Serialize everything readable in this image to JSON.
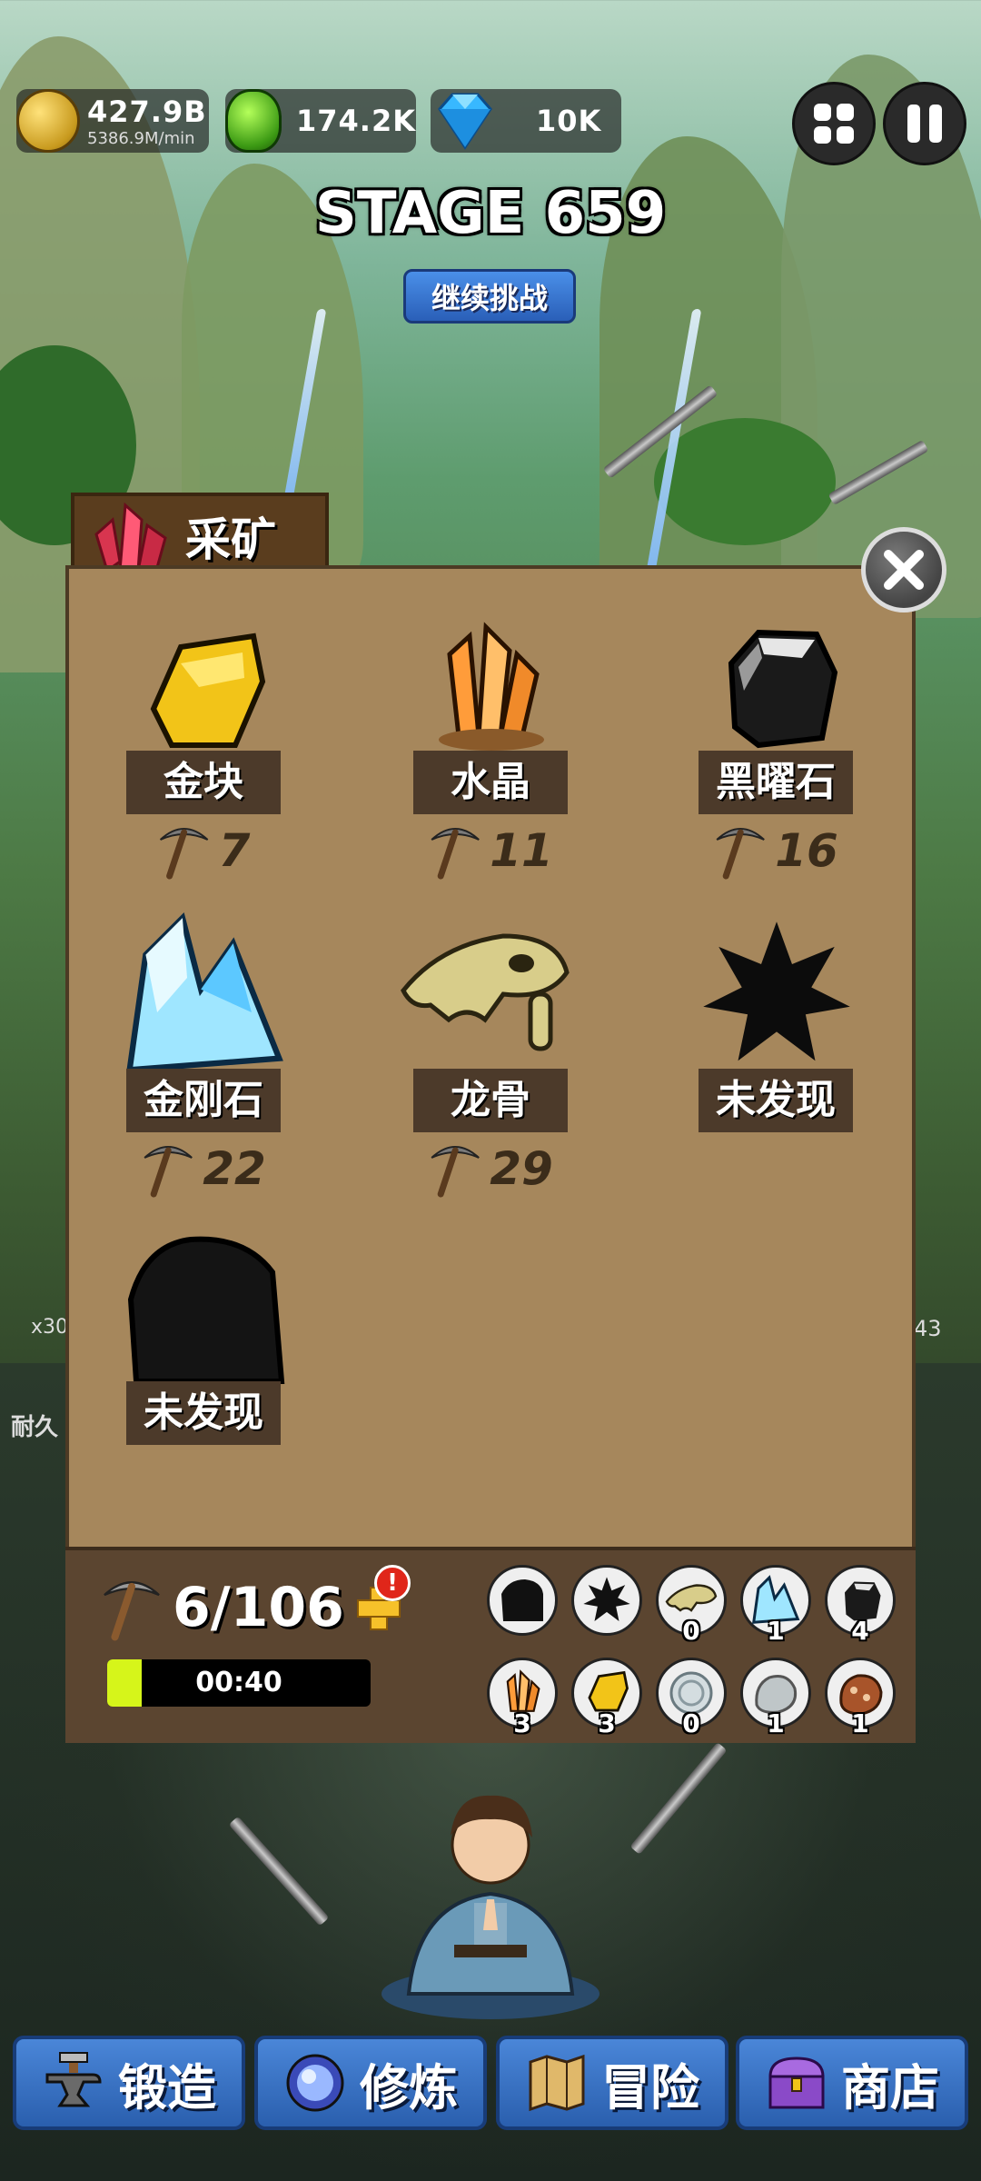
{
  "resources": {
    "gold": "427.9B",
    "gold_rate": "5386.9M/min",
    "slime": "174.2K",
    "diamond": "10K"
  },
  "stage": {
    "title": "STAGE 659",
    "continue_label": "继续挑战"
  },
  "mining": {
    "title": "采矿",
    "minerals": [
      {
        "name": "金块",
        "cost": "7",
        "icon": "gold-nugget-icon"
      },
      {
        "name": "水晶",
        "cost": "11",
        "icon": "crystal-icon"
      },
      {
        "name": "黑曜石",
        "cost": "16",
        "icon": "obsidian-icon"
      },
      {
        "name": "金刚石",
        "cost": "22",
        "icon": "diamond-ore-icon"
      },
      {
        "name": "龙骨",
        "cost": "29",
        "icon": "dragon-bone-icon"
      },
      {
        "name": "未发现",
        "cost": "",
        "icon": "undiscovered-icon"
      },
      {
        "name": "未发现",
        "cost": "",
        "icon": "undiscovered-rock-icon"
      }
    ],
    "pickaxe_count": "6/106",
    "alert": "!",
    "timer": "00:40",
    "timer_progress": 0.13,
    "inventory": [
      {
        "icon": "undiscovered-rock-icon",
        "qty": ""
      },
      {
        "icon": "undiscovered-icon",
        "qty": ""
      },
      {
        "icon": "dragon-bone-icon",
        "qty": "0"
      },
      {
        "icon": "diamond-ore-icon",
        "qty": "1"
      },
      {
        "icon": "obsidian-icon",
        "qty": "4"
      },
      {
        "icon": "crystal-icon",
        "qty": "3"
      },
      {
        "icon": "gold-nugget-icon",
        "qty": "3"
      },
      {
        "icon": "silver-coin-icon",
        "qty": "0"
      },
      {
        "icon": "silver-ore-icon",
        "qty": "1"
      },
      {
        "icon": "copper-ore-icon",
        "qty": "1"
      }
    ]
  },
  "side": {
    "left_count": "x30",
    "right_count": "43",
    "durability_label": "耐久"
  },
  "nav": {
    "forge": "锻造",
    "cultivate": "修炼",
    "adventure": "冒险",
    "shop": "商店"
  },
  "colors": {
    "panel": "#a6875c",
    "panel_border": "#4c3a24",
    "nav_blue": "#2a5fae",
    "timer_fill": "#d6f51a"
  }
}
